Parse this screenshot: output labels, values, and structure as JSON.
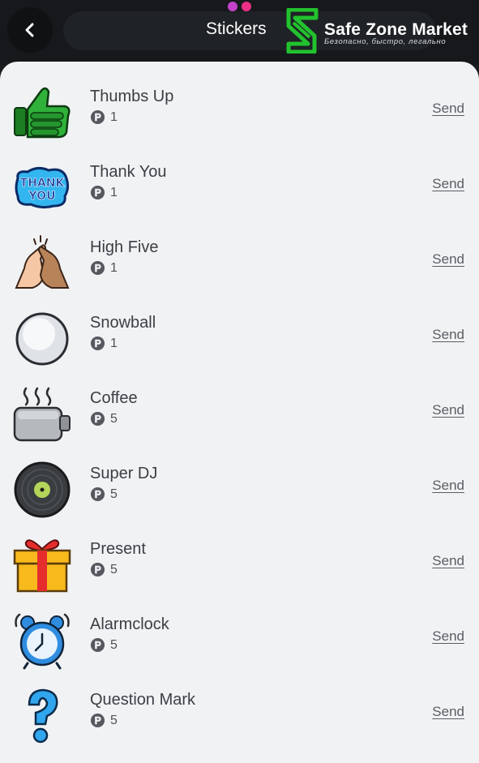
{
  "header": {
    "title": "Stickers",
    "back_icon": "chevron-left-icon",
    "brand_name": "Safe Zone Market",
    "brand_tagline": "Безопасно, быстро, легально",
    "brand_color": "#22c22e",
    "dot_colors": [
      "#c342c9",
      "#ee2f86"
    ]
  },
  "stickers": [
    {
      "name": "Thumbs Up",
      "price": "1",
      "icon": "thumbs-up-icon",
      "action": "Send"
    },
    {
      "name": "Thank You",
      "price": "1",
      "icon": "thank-you-icon",
      "action": "Send"
    },
    {
      "name": "High Five",
      "price": "1",
      "icon": "high-five-icon",
      "action": "Send"
    },
    {
      "name": "Snowball",
      "price": "1",
      "icon": "snowball-icon",
      "action": "Send"
    },
    {
      "name": "Coffee",
      "price": "5",
      "icon": "coffee-icon",
      "action": "Send"
    },
    {
      "name": "Super DJ",
      "price": "5",
      "icon": "vinyl-record-icon",
      "action": "Send"
    },
    {
      "name": "Present",
      "price": "5",
      "icon": "gift-icon",
      "action": "Send"
    },
    {
      "name": "Alarmclock",
      "price": "5",
      "icon": "alarm-clock-icon",
      "action": "Send"
    },
    {
      "name": "Question Mark",
      "price": "5",
      "icon": "question-mark-icon",
      "action": "Send"
    }
  ],
  "colors": {
    "sheet_bg": "#f1f2f4",
    "text_primary": "#3b3e44",
    "text_secondary": "#4e5258"
  }
}
